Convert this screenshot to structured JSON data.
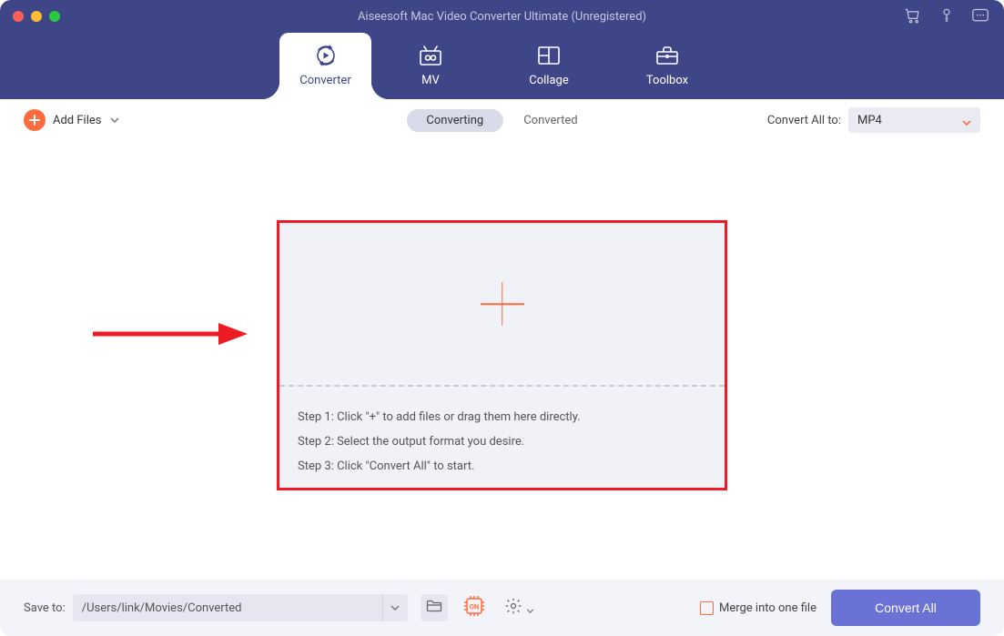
{
  "colors": {
    "brand_bg": "#3f4687",
    "accent": "#ff6b3d",
    "primary_btn": "#6b72d5",
    "annotation_red": "#ed1c24"
  },
  "window": {
    "title": "Aiseesoft Mac Video Converter Ultimate (Unregistered)"
  },
  "nav": {
    "tabs": [
      {
        "label": "Converter",
        "icon": "converter-icon",
        "active": true
      },
      {
        "label": "MV",
        "icon": "mv-icon",
        "active": false
      },
      {
        "label": "Collage",
        "icon": "collage-icon",
        "active": false
      },
      {
        "label": "Toolbox",
        "icon": "toolbox-icon",
        "active": false
      }
    ]
  },
  "toolbar": {
    "add_files_label": "Add Files",
    "segments": {
      "converting": "Converting",
      "converted": "Converted"
    },
    "convert_all_to_label": "Convert All to:",
    "format_selected": "MP4"
  },
  "dropzone": {
    "steps": [
      "Step 1: Click \"+\" to add files or drag them here directly.",
      "Step 2: Select the output format you desire.",
      "Step 3: Click \"Convert All\" to start."
    ]
  },
  "footer": {
    "save_to_label": "Save to:",
    "save_path": "/Users/link/Movies/Converted",
    "merge_label": "Merge into one file",
    "convert_all_btn": "Convert All"
  }
}
